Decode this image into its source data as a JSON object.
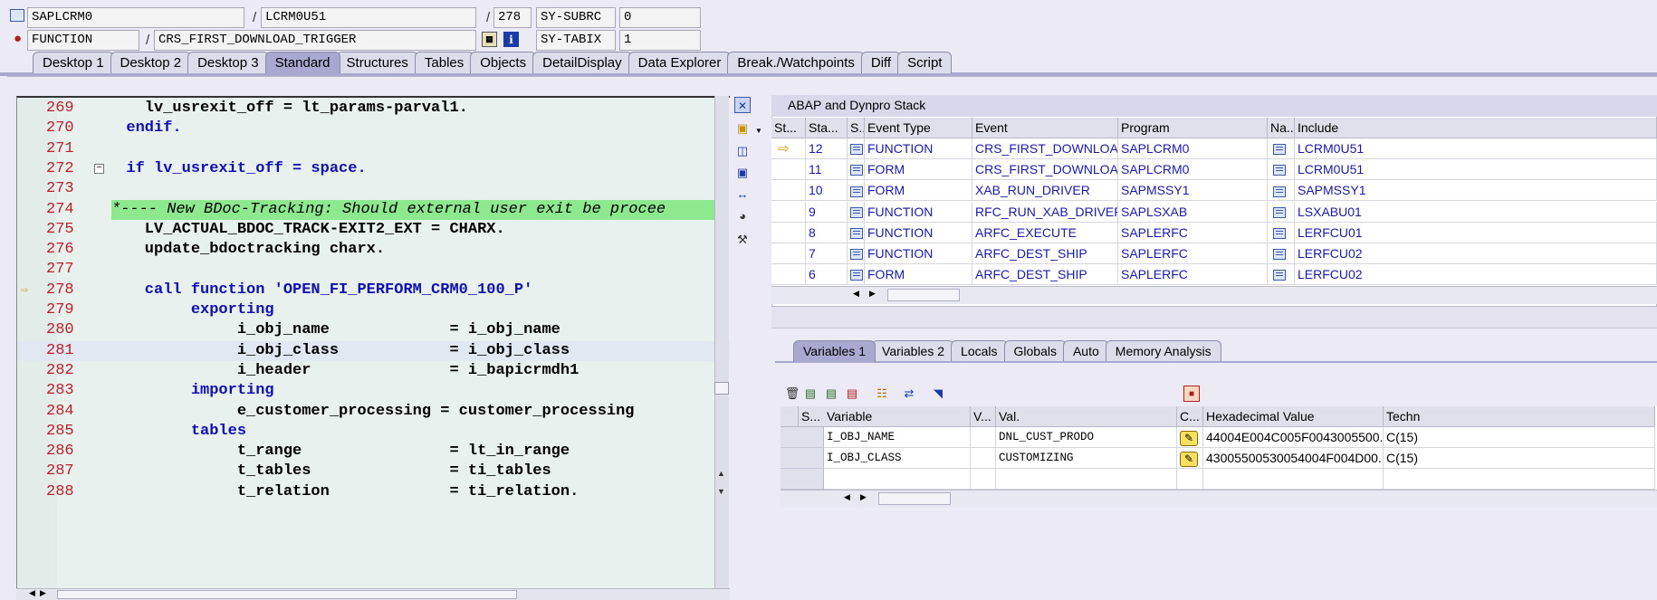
{
  "header": {
    "program": "SAPLCRM0",
    "include": "LCRM0U51",
    "line": "278",
    "sy_subrc_label": "SY-SUBRC",
    "sy_subrc_value": "0",
    "type": "FUNCTION",
    "name": "CRS_FIRST_DOWNLOAD_TRIGGER",
    "sy_tabix_label": "SY-TABIX",
    "sy_tabix_value": "1",
    "separator": "/"
  },
  "tabs": [
    "Desktop 1",
    "Desktop 2",
    "Desktop 3",
    "Standard",
    "Structures",
    "Tables",
    "Objects",
    "DetailDisplay",
    "Data Explorer",
    "Break./Watchpoints",
    "Diff",
    "Script"
  ],
  "active_tab": "Standard",
  "code": {
    "lines": [
      {
        "n": "269",
        "text": "    lv_usrexit_off = lt_params-parval1."
      },
      {
        "n": "270",
        "text": "  endif."
      },
      {
        "n": "271",
        "text": ""
      },
      {
        "n": "272",
        "text": "  if lv_usrexit_off = space."
      },
      {
        "n": "273",
        "text": ""
      },
      {
        "n": "274",
        "text": "*---- New BDoc-Tracking: Should external user exit be procee"
      },
      {
        "n": "275",
        "text": "    LV_ACTUAL_BDOC_TRACK-EXIT2_EXT = CHARX."
      },
      {
        "n": "276",
        "text": "    update_bdoctracking charx."
      },
      {
        "n": "277",
        "text": ""
      },
      {
        "n": "278",
        "text": "    call function 'OPEN_FI_PERFORM_CRM0_100_P'"
      },
      {
        "n": "279",
        "text": "         exporting"
      },
      {
        "n": "280",
        "text": "              i_obj_name             = i_obj_name"
      },
      {
        "n": "281",
        "text": "              i_obj_class            = i_obj_class"
      },
      {
        "n": "282",
        "text": "              i_header               = i_bapicrmdh1"
      },
      {
        "n": "283",
        "text": "         importing"
      },
      {
        "n": "284",
        "text": "              e_customer_processing = customer_processing"
      },
      {
        "n": "285",
        "text": "         tables"
      },
      {
        "n": "286",
        "text": "              t_range                = lt_in_range"
      },
      {
        "n": "287",
        "text": "              t_tables               = ti_tables"
      },
      {
        "n": "288",
        "text": "              t_relation             = ti_relation."
      }
    ]
  },
  "stack": {
    "title": "ABAP and Dynpro Stack",
    "columns": [
      "St...",
      "Sta...",
      "S...",
      "Event Type",
      "Event",
      "Program",
      "Na...",
      "Include"
    ],
    "rows": [
      {
        "level": "12",
        "type": "FUNCTION",
        "event": "CRS_FIRST_DOWNLOAD...",
        "program": "SAPLCRM0",
        "include": "LCRM0U51"
      },
      {
        "level": "11",
        "type": "FORM",
        "event": "CRS_FIRST_DOWNLOAD...",
        "program": "SAPLCRM0",
        "include": "LCRM0U51"
      },
      {
        "level": "10",
        "type": "FORM",
        "event": "XAB_RUN_DRIVER",
        "program": "SAPMSSY1",
        "include": "SAPMSSY1"
      },
      {
        "level": "9",
        "type": "FUNCTION",
        "event": "RFC_RUN_XAB_DRIVER",
        "program": "SAPLSXAB",
        "include": "LSXABU01"
      },
      {
        "level": "8",
        "type": "FUNCTION",
        "event": "ARFC_EXECUTE",
        "program": "SAPLERFC",
        "include": "LERFCU01"
      },
      {
        "level": "7",
        "type": "FUNCTION",
        "event": "ARFC_DEST_SHIP",
        "program": "SAPLERFC",
        "include": "LERFCU02"
      },
      {
        "level": "6",
        "type": "FORM",
        "event": "ARFC_DEST_SHIP",
        "program": "SAPLERFC",
        "include": "LERFCU02"
      }
    ]
  },
  "vartabs": [
    "Variables 1",
    "Variables 2",
    "Locals",
    "Globals",
    "Auto",
    "Memory Analysis"
  ],
  "active_vartab": "Variables 1",
  "variables": {
    "columns": [
      "S...",
      "Variable",
      "V...",
      "Val.",
      "C...",
      "Hexadecimal Value",
      "Techn"
    ],
    "rows": [
      {
        "name": "I_OBJ_NAME",
        "value": "DNL_CUST_PRODO",
        "hex": "44004E004C005F0043005500...",
        "tech": "C(15)"
      },
      {
        "name": "I_OBJ_CLASS",
        "value": "CUSTOMIZING",
        "hex": "43005500530054004F004D00...",
        "tech": "C(15)"
      }
    ]
  },
  "icons": {
    "program_icon": "program-icon",
    "function_icon": "function-module-icon",
    "current_line_marker": "arrow-right-icon"
  },
  "colors": {
    "accent": "#a8a8d0",
    "highlight_comment": "#8ee88e",
    "line_numbers": "#b8202a",
    "keyword": "#1010b0"
  }
}
